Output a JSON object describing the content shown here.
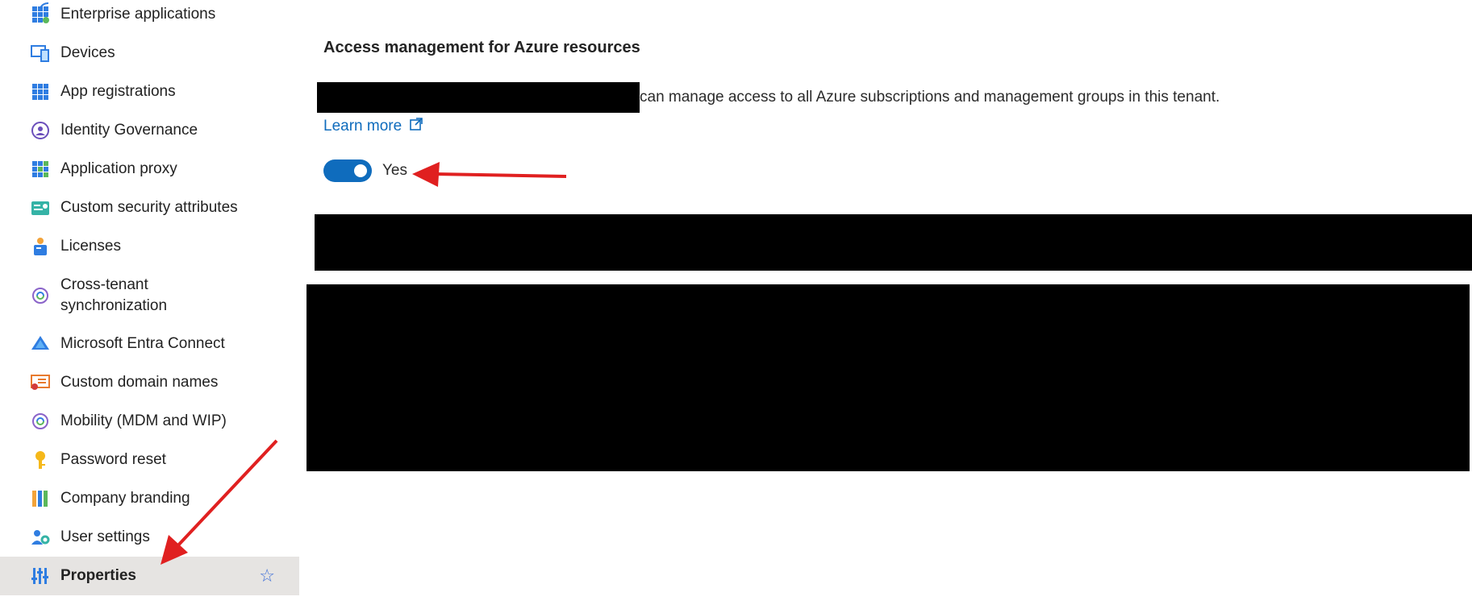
{
  "sidebar": {
    "items": [
      {
        "label": "Enterprise applications",
        "icon": "enterprise-apps-icon"
      },
      {
        "label": "Devices",
        "icon": "devices-icon"
      },
      {
        "label": "App registrations",
        "icon": "app-registrations-icon"
      },
      {
        "label": "Identity Governance",
        "icon": "identity-governance-icon"
      },
      {
        "label": "Application proxy",
        "icon": "application-proxy-icon"
      },
      {
        "label": "Custom security attributes",
        "icon": "custom-security-attributes-icon"
      },
      {
        "label": "Licenses",
        "icon": "licenses-icon"
      },
      {
        "label": "Cross-tenant synchronization",
        "icon": "cross-tenant-sync-icon"
      },
      {
        "label": "Microsoft Entra Connect",
        "icon": "entra-connect-icon"
      },
      {
        "label": "Custom domain names",
        "icon": "custom-domain-icon"
      },
      {
        "label": "Mobility (MDM and WIP)",
        "icon": "mobility-icon"
      },
      {
        "label": "Password reset",
        "icon": "key-icon"
      },
      {
        "label": "Company branding",
        "icon": "company-branding-icon"
      },
      {
        "label": "User settings",
        "icon": "user-settings-icon"
      },
      {
        "label": "Properties",
        "icon": "properties-icon",
        "selected": true,
        "favorite_icon": "star-icon"
      }
    ]
  },
  "main": {
    "section_title": "Access management for Azure resources",
    "description": "can manage access to all Azure subscriptions and management groups in this tenant.",
    "learn_more": "Learn more",
    "toggle": {
      "on": true,
      "label": "Yes"
    }
  },
  "colors": {
    "accent": "#0f6cbd",
    "selected_bg": "#e6e4e2",
    "annotation_arrow": "#e02020"
  }
}
